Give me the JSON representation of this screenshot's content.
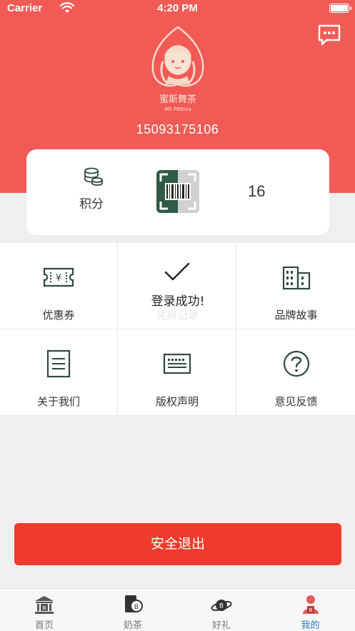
{
  "status_bar": {
    "carrier": "Carrier",
    "time": "4:20 PM"
  },
  "header": {
    "logo": {
      "brand_cn": "蜜斯舞茶",
      "brand_en": "MS PREtea"
    },
    "phone": "15093175106",
    "chat_icon": "chat-bubble-icon",
    "background_color": "#f25a55"
  },
  "points_card": {
    "label": "积分",
    "value": "16",
    "barcode_icon": "barcode-scan-icon"
  },
  "grid": [
    {
      "label": "优惠券",
      "icon": "coupon-ticket-icon"
    },
    {
      "label": "兑换记录",
      "icon": "history-icon"
    },
    {
      "label": "品牌故事",
      "icon": "building-icon"
    },
    {
      "label": "关于我们",
      "icon": "document-icon"
    },
    {
      "label": "版权声明",
      "icon": "keyboard-icon"
    },
    {
      "label": "意见反馈",
      "icon": "question-icon"
    }
  ],
  "toast": {
    "message": "登录成功!"
  },
  "logout": {
    "label": "安全退出",
    "color": "#ef3b2d"
  },
  "tabbar": {
    "active_color": "#2e78c8",
    "tabs": [
      {
        "label": "首页",
        "icon": "bank-home-icon",
        "active": false
      },
      {
        "label": "奶茶",
        "icon": "milk-tea-icon",
        "active": false
      },
      {
        "label": "好礼",
        "icon": "planet-gift-icon",
        "active": false
      },
      {
        "label": "我的",
        "icon": "user-profile-icon",
        "active": true
      }
    ]
  }
}
